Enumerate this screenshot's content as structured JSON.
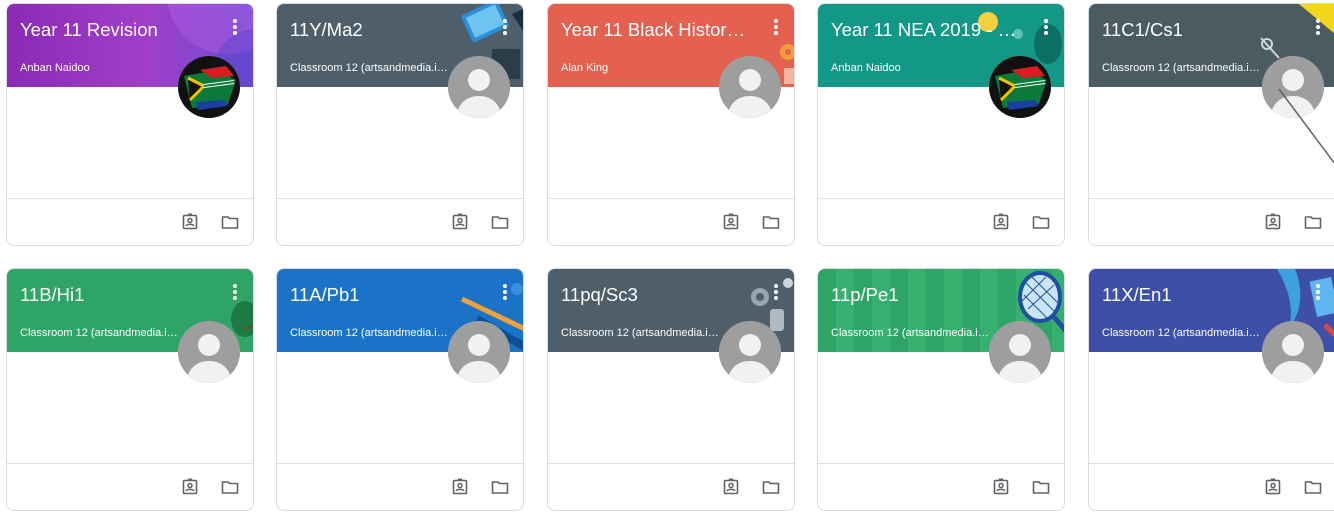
{
  "colors": {
    "purple": "#8e2fb5",
    "slate": "#4e5f6b",
    "coral": "#e4604f",
    "teal": "#139786",
    "darkslate": "#4a5b62",
    "green": "#2ea566",
    "blue": "#1a73c7",
    "indigo": "#3d4fa7"
  },
  "cards": [
    {
      "title": "Year 11 Revision",
      "subtitle": "Anban Naidoo",
      "avatar": "flag-avatar"
    },
    {
      "title": "11Y/Ma2",
      "subtitle": "Classroom 12 (artsandmedia.is...",
      "avatar": "default-avatar"
    },
    {
      "title": "Year 11 Black History ...",
      "subtitle": "Alan King",
      "avatar": "default-avatar"
    },
    {
      "title": "Year 11 NEA 2019 - 20...",
      "subtitle": "Anban Naidoo",
      "avatar": "flag-avatar"
    },
    {
      "title": "11C1/Cs1",
      "subtitle": "Classroom 12 (artsandmedia.is...",
      "avatar": "default-avatar"
    },
    {
      "title": "11B/Hi1",
      "subtitle": "Classroom 12 (artsandmedia.is...",
      "avatar": "default-avatar"
    },
    {
      "title": "11A/Pb1",
      "subtitle": "Classroom 12 (artsandmedia.is...",
      "avatar": "default-avatar"
    },
    {
      "title": "11pq/Sc3",
      "subtitle": "Classroom 12 (artsandmedia.is...",
      "avatar": "default-avatar"
    },
    {
      "title": "11p/Pe1",
      "subtitle": "Classroom 12 (artsandmedia.is...",
      "avatar": "default-avatar"
    },
    {
      "title": "11X/En1",
      "subtitle": "Classroom 12 (artsandmedia.is...",
      "avatar": "default-avatar"
    }
  ]
}
